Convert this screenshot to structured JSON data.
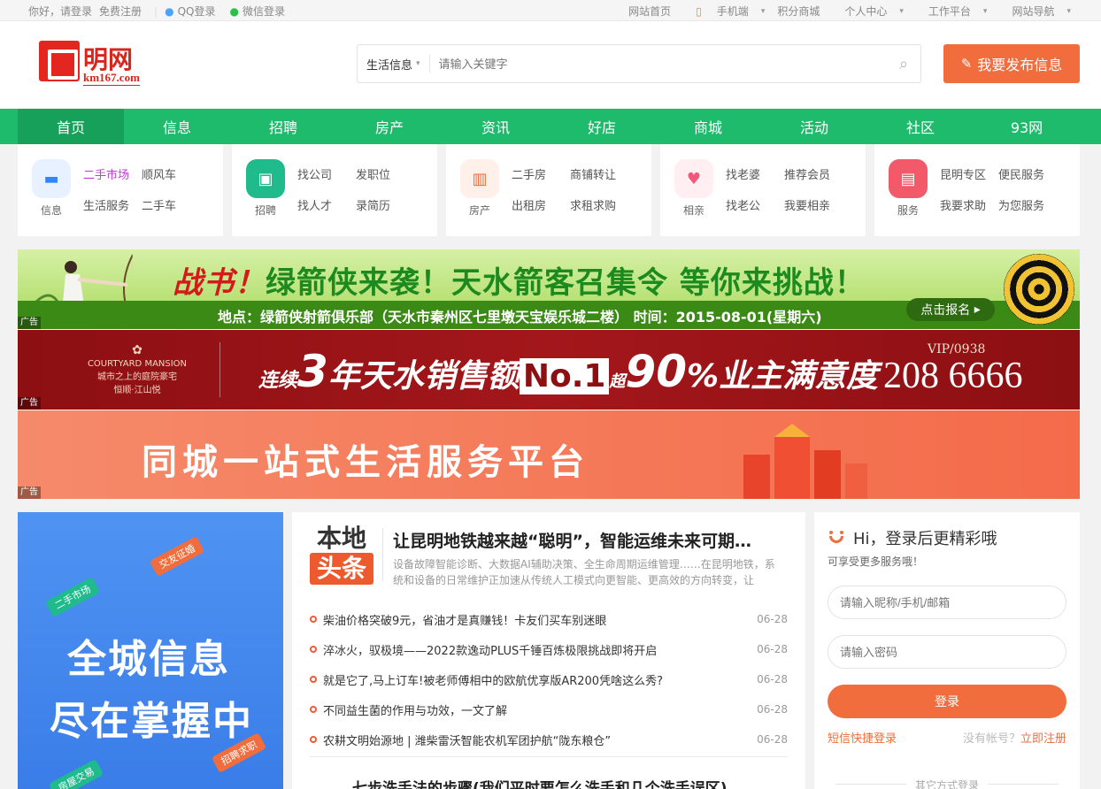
{
  "topbar": {
    "greeting": "你好，请登录",
    "register": "免费注册",
    "qq_login": "QQ登录",
    "wechat_login": "微信登录",
    "home": "网站首页",
    "mobile": "手机端",
    "points_mall": "积分商城",
    "personal_center": "个人中心",
    "workbench": "工作平台",
    "site_nav": "网站导航"
  },
  "header": {
    "logo_name": "明网",
    "logo_domain": "km167.com",
    "search_category": "生活信息",
    "search_placeholder": "请输入关键字",
    "publish_label": "我要发布信息"
  },
  "nav": [
    "首页",
    "信息",
    "招聘",
    "房产",
    "资讯",
    "好店",
    "商城",
    "活动",
    "社区",
    "93网"
  ],
  "categories": [
    {
      "label": "信息",
      "links": [
        "二手市场",
        "顺风车",
        "生活服务",
        "二手车"
      ],
      "color": "#e8f1ff",
      "icon_color": "#2f86f6"
    },
    {
      "label": "招聘",
      "links": [
        "找公司",
        "发职位",
        "找人才",
        "录简历"
      ],
      "color": "#1fbb8c",
      "icon_color": "#ffffff"
    },
    {
      "label": "房产",
      "links": [
        "二手房",
        "商铺转让",
        "出租房",
        "求租求购"
      ],
      "color": "#fff0ea",
      "icon_color": "#f26d3d"
    },
    {
      "label": "相亲",
      "links": [
        "找老婆",
        "推荐会员",
        "找老公",
        "我要相亲"
      ],
      "color": "#ffeef2",
      "icon_color": "#f2587a"
    },
    {
      "label": "服务",
      "links": [
        "昆明专区",
        "便民服务",
        "我要求助",
        "为您服务"
      ],
      "color": "#f25a6a",
      "icon_color": "#ffffff"
    }
  ],
  "banners": {
    "ad_tag": "广告",
    "b1_title_red": "战书！",
    "b1_title": "绿箭侠来袭！天水箭客召集令 等你来挑战！",
    "b1_sub": "地点：绿箭侠射箭俱乐部（天水市秦州区七里墩天宝娱乐城二楼） 时间：2015-08-01(星期六)",
    "b1_signup": "点击报名",
    "b2_mansion_en": "COURTYARD MANSION",
    "b2_mansion_cn": "城市之上的庭院豪宅",
    "b2_mansion_name": "恒顺·江山悦",
    "b2_lian": "连续",
    "b2_3": "3",
    "b2_mid": "年天水销售额",
    "b2_no1": "No.1",
    "b2_chao": "超",
    "b2_90": "90",
    "b2_end": "%业主满意度",
    "b2_vip": "VIP/0938",
    "b2_phone": "208 6666",
    "b3_slogan": "同城一站式生活服务平台"
  },
  "promo": {
    "line1": "全城信息",
    "line2": "尽在掌握中",
    "chip1": "交友征婚",
    "chip2": "二手市场",
    "chip3": "招聘求职",
    "chip4": "房屋交易"
  },
  "news": {
    "badge_top": "本地",
    "badge_bottom": "头条",
    "headline": "让昆明地铁越来越“聪明”，智能运维未来可期…",
    "summary": "设备故障智能诊断、大数据AI辅助决策、全生命周期运维管理……在昆明地铁，系统和设备的日常维护正加速从传统人工模式向更智能、更高效的方向转变，让",
    "items": [
      {
        "title": "柴油价格突破9元，省油才是真赚钱！卡友们买车别迷眼",
        "date": "06-28"
      },
      {
        "title": "淬冰火，驭极境——2022款逸动PLUS千锤百炼极限挑战即将开启",
        "date": "06-28"
      },
      {
        "title": "就是它了,马上订车!被老师傅相中的欧航优享版AR200凭啥这么秀?",
        "date": "06-28"
      },
      {
        "title": "不同益生菌的作用与功效，一文了解",
        "date": "06-28"
      },
      {
        "title": "农耕文明始源地 | 潍柴雷沃智能农机军团护航“陇东粮仓”",
        "date": "06-28"
      }
    ],
    "next_headline": "七步洗手法的步骤(我们平时要怎么洗手和几个洗手误区)"
  },
  "login": {
    "hi": "Hi，登录后更精彩哦",
    "sub": "可享受更多服务哦！",
    "user_placeholder": "请输入昵称/手机/邮箱",
    "pass_placeholder": "请输入密码",
    "login_button": "登录",
    "sms_login": "短信快捷登录",
    "no_account": "没有帐号？",
    "register_now": "立即注册",
    "other_login": "其它方式登录"
  }
}
